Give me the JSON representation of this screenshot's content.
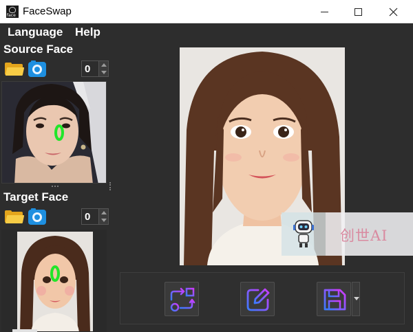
{
  "window": {
    "title": "FaceSwap",
    "icon": "face-app-icon",
    "icon_text": "face"
  },
  "menu": {
    "items": [
      {
        "label": "Language"
      },
      {
        "label": "Help"
      }
    ]
  },
  "source": {
    "title": "Source Face",
    "index": "0",
    "marker": "0"
  },
  "target": {
    "title": "Target Face",
    "index": "0",
    "marker": "0"
  },
  "actions": {
    "swap_icon": "swap-faces-icon",
    "edit_icon": "edit-icon",
    "save_icon": "save-icon"
  },
  "watermark": {
    "text": "创世AI",
    "icon": "robot-icon"
  },
  "colors": {
    "background": "#2d2d2d",
    "marker": "#22e62a",
    "accent_gradient_start": "#3a7bff",
    "accent_gradient_end": "#d03aff",
    "folder": "#f7cc46",
    "camera": "#1e8fe0"
  }
}
